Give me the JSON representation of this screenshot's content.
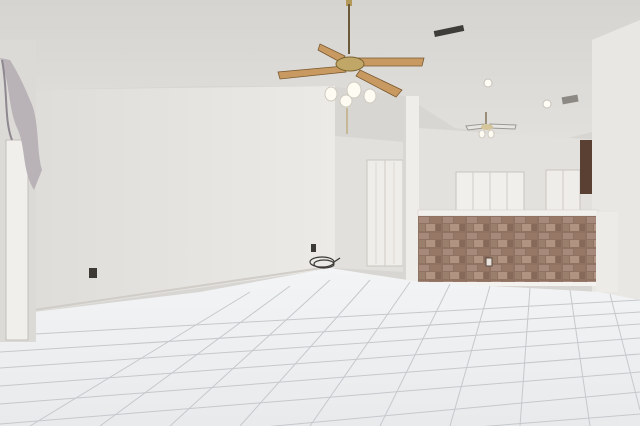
{
  "scene": {
    "type": "photo",
    "subject": "empty-interior-room",
    "palette": {
      "ceiling": "#dcdad6",
      "wall_left": "#e7e5e1",
      "wall_back": "#dedcd8",
      "floor_tile": "#eef0f1",
      "grout": "#c9ccce",
      "stone_counter": "#9b7e6c",
      "fan_blade": "#c89a62",
      "door": "#eceae6",
      "curtain": "#b9b3b8"
    },
    "icons": [
      "ceiling-fan-icon",
      "recessed-light-icon",
      "air-vent-icon",
      "power-outlet-icon",
      "cable-coil-icon"
    ]
  }
}
